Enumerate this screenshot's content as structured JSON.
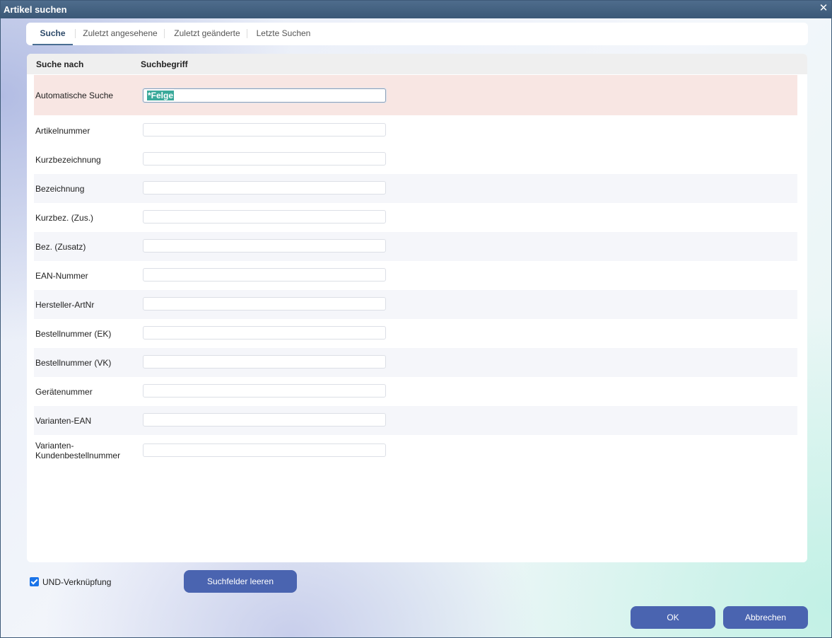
{
  "window": {
    "title": "Artikel suchen"
  },
  "tabs": [
    {
      "label": "Suche",
      "active": true
    },
    {
      "label": "Zuletzt angesehene",
      "active": false
    },
    {
      "label": "Zuletzt geänderte",
      "active": false
    },
    {
      "label": "Letzte Suchen",
      "active": false
    }
  ],
  "table": {
    "col_search_by": "Suche nach",
    "col_term": "Suchbegriff"
  },
  "fields": [
    {
      "label": "Automatische Suche",
      "value": "*Felge",
      "selected": true
    },
    {
      "label": "Artikelnummer",
      "value": ""
    },
    {
      "label": "Kurzbezeichnung",
      "value": ""
    },
    {
      "label": "Bezeichnung",
      "value": ""
    },
    {
      "label": "Kurzbez. (Zus.)",
      "value": ""
    },
    {
      "label": "Bez. (Zusatz)",
      "value": ""
    },
    {
      "label": "EAN-Nummer",
      "value": ""
    },
    {
      "label": "Hersteller-ArtNr",
      "value": ""
    },
    {
      "label": "Bestellnummer (EK)",
      "value": ""
    },
    {
      "label": "Bestellnummer (VK)",
      "value": ""
    },
    {
      "label": "Gerätenummer",
      "value": ""
    },
    {
      "label": "Varianten-EAN",
      "value": ""
    },
    {
      "label_line1": "Varianten-",
      "label_line2": "Kundenbestellnummer",
      "value": ""
    }
  ],
  "footer": {
    "and_link_label": "UND-Verknüpfung",
    "and_link_checked": true,
    "clear_button": "Suchfelder leeren",
    "ok_button": "OK",
    "cancel_button": "Abbrechen"
  },
  "colors": {
    "titlebar": "#3b5877",
    "button": "#4a64b0",
    "highlight_row": "#f8e6e3",
    "selection": "#3aa99a"
  }
}
